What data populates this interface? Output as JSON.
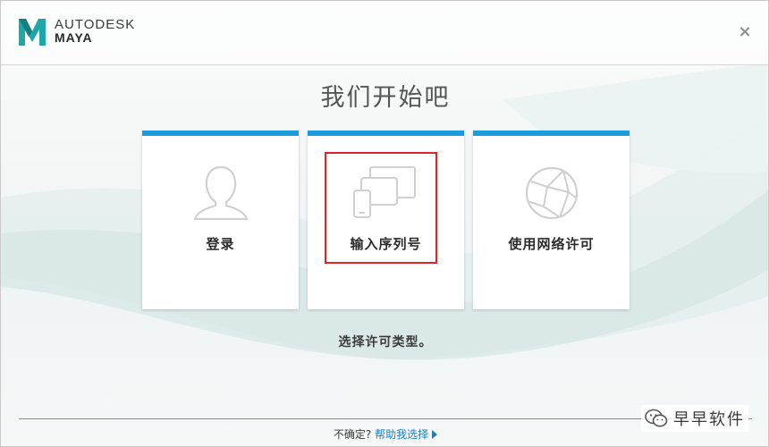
{
  "header": {
    "brand_line1": "AUTODESK",
    "brand_line2": "MAYA",
    "close_glyph": "×"
  },
  "main": {
    "title": "我们开始吧",
    "cards": [
      {
        "label": "登录",
        "icon": "user-icon"
      },
      {
        "label": "输入序列号",
        "icon": "devices-icon",
        "highlighted": true
      },
      {
        "label": "使用网络许可",
        "icon": "network-globe-icon"
      }
    ],
    "hint": "选择许可类型。"
  },
  "footer": {
    "question": "不确定?",
    "help_link": "帮助我选择"
  },
  "watermark": {
    "text": "早早软件",
    "icon": "wechat-icon"
  },
  "colors": {
    "accent": "#1b9cdd",
    "highlight": "#d8262b",
    "link": "#1b7fc4",
    "logo_teal": "#1fa6a6"
  }
}
